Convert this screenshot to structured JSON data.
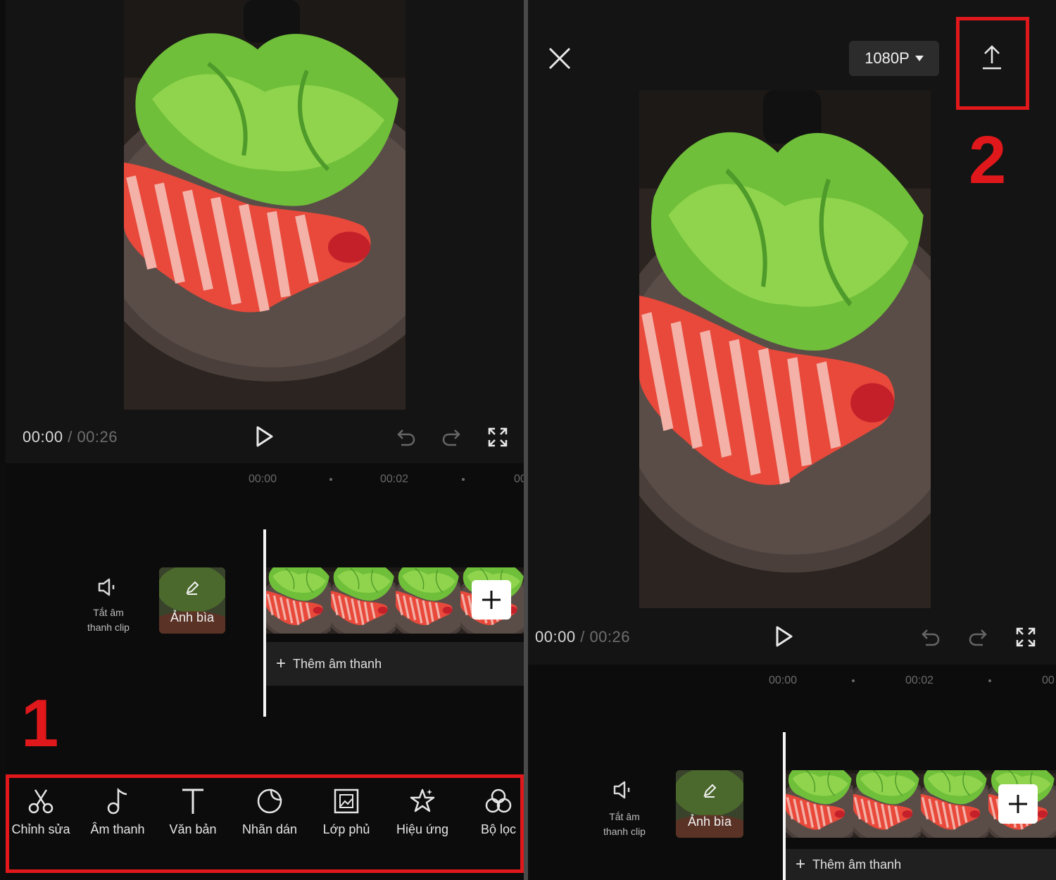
{
  "colors": {
    "annotation_red": "#e0181b",
    "background": "#141414",
    "text_muted": "#6e6e6e"
  },
  "left_screen": {
    "annotation_number": "1",
    "timecode_current": "00:00",
    "timecode_separator": "/",
    "timecode_total": "00:26",
    "ruler_marks": [
      "00:00",
      "00:02",
      "00"
    ],
    "mute_clip_label_line1": "Tắt âm",
    "mute_clip_label_line2": "thanh clip",
    "cover_label": "Ảnh bìa",
    "add_audio_label": "Thêm âm thanh",
    "toolbar": [
      {
        "label": "Chỉnh sửa",
        "icon": "scissors-icon"
      },
      {
        "label": "Âm thanh",
        "icon": "music-note-icon"
      },
      {
        "label": "Văn bản",
        "icon": "text-icon"
      },
      {
        "label": "Nhãn dán",
        "icon": "sticker-icon"
      },
      {
        "label": "Lớp phủ",
        "icon": "overlay-icon"
      },
      {
        "label": "Hiệu ứng",
        "icon": "effects-star-icon"
      },
      {
        "label": "Bộ lọc",
        "icon": "filter-icon"
      }
    ]
  },
  "right_screen": {
    "annotation_number": "2",
    "resolution_label": "1080P",
    "timecode_current": "00:00",
    "timecode_separator": "/",
    "timecode_total": "00:26",
    "ruler_marks": [
      "00:00",
      "00:02",
      "00"
    ],
    "mute_clip_label_line1": "Tắt âm",
    "mute_clip_label_line2": "thanh clip",
    "cover_label": "Ảnh bìa",
    "add_audio_label": "Thêm âm thanh"
  }
}
